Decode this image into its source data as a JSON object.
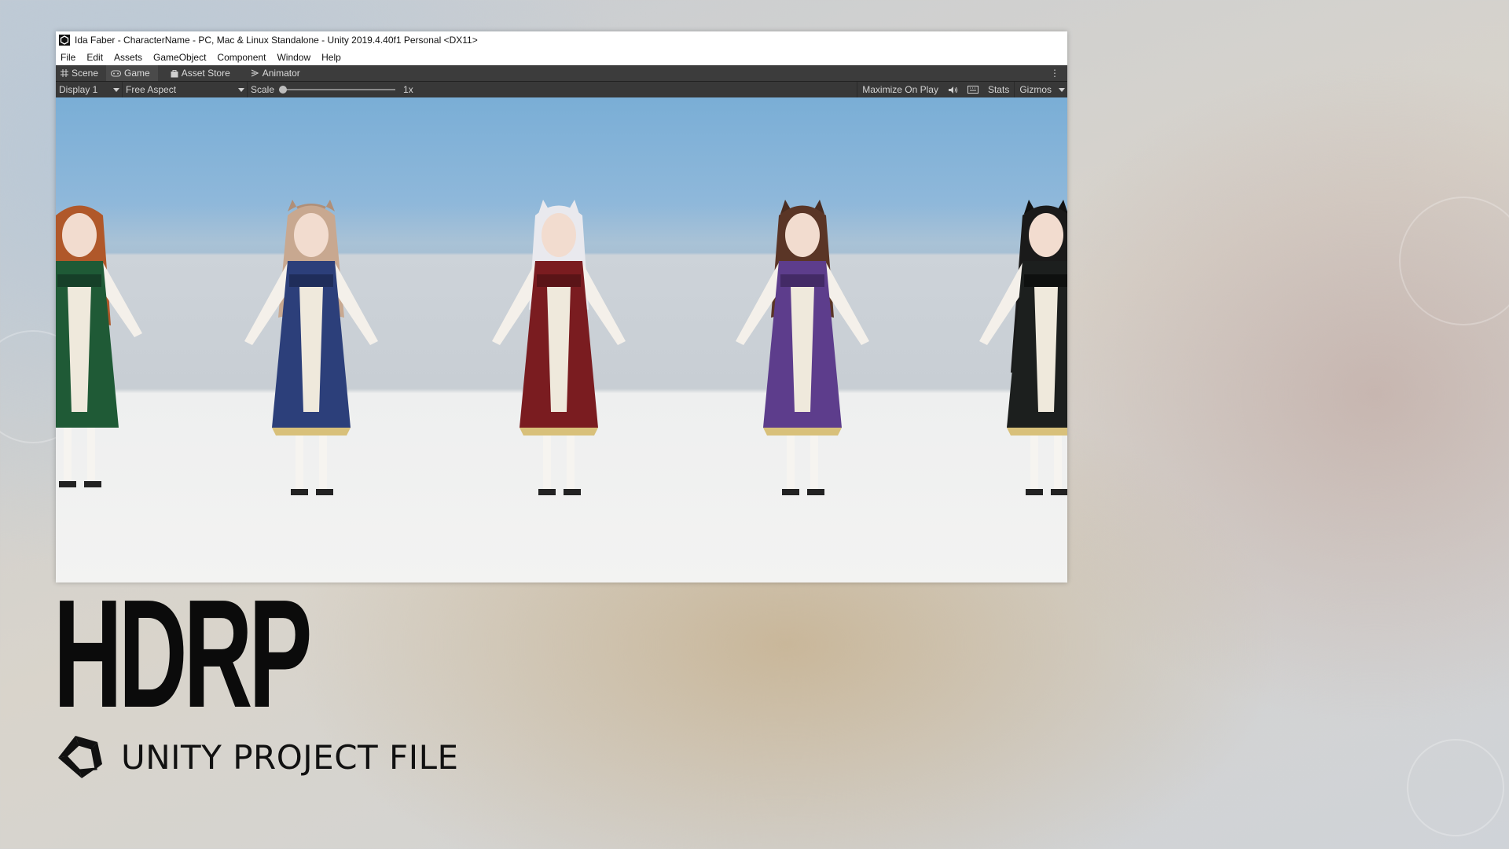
{
  "window": {
    "title": "Ida Faber - CharacterName - PC, Mac & Linux Standalone - Unity 2019.4.40f1 Personal <DX11>"
  },
  "menu": [
    "File",
    "Edit",
    "Assets",
    "GameObject",
    "Component",
    "Window",
    "Help"
  ],
  "tabs": [
    {
      "label": "Scene",
      "icon": "grid-icon"
    },
    {
      "label": "Game",
      "icon": "gamepad-icon",
      "active": true
    },
    {
      "label": "Asset Store",
      "icon": "bag-icon"
    },
    {
      "label": "Animator",
      "icon": "animator-icon"
    }
  ],
  "toolbar": {
    "display": "Display 1",
    "aspect": "Free Aspect",
    "scale_label": "Scale",
    "scale_value": "1x",
    "maximize": "Maximize On Play",
    "stats": "Stats",
    "gizmos": "Gizmos"
  },
  "characters": [
    {
      "hair": "#b0582a",
      "dress": "#1f5a36",
      "label": "green-dress-character"
    },
    {
      "hair": "#c8a890",
      "dress": "#2c3f7a",
      "label": "blue-dress-character"
    },
    {
      "hair": "#e9e9ee",
      "dress": "#7a1c20",
      "label": "red-dress-character"
    },
    {
      "hair": "#5a3526",
      "dress": "#5d3d8c",
      "label": "purple-dress-character"
    },
    {
      "hair": "#1a1a1a",
      "dress": "#1c1f1e",
      "label": "black-dress-character"
    }
  ],
  "branding": {
    "headline": "HDRP",
    "subtitle": "UNITY PROJECT FILE"
  },
  "colors": {
    "toolbar_bg": "#383838",
    "tabbar_bg": "#3c3c3c",
    "sky": "#7aaed6"
  }
}
